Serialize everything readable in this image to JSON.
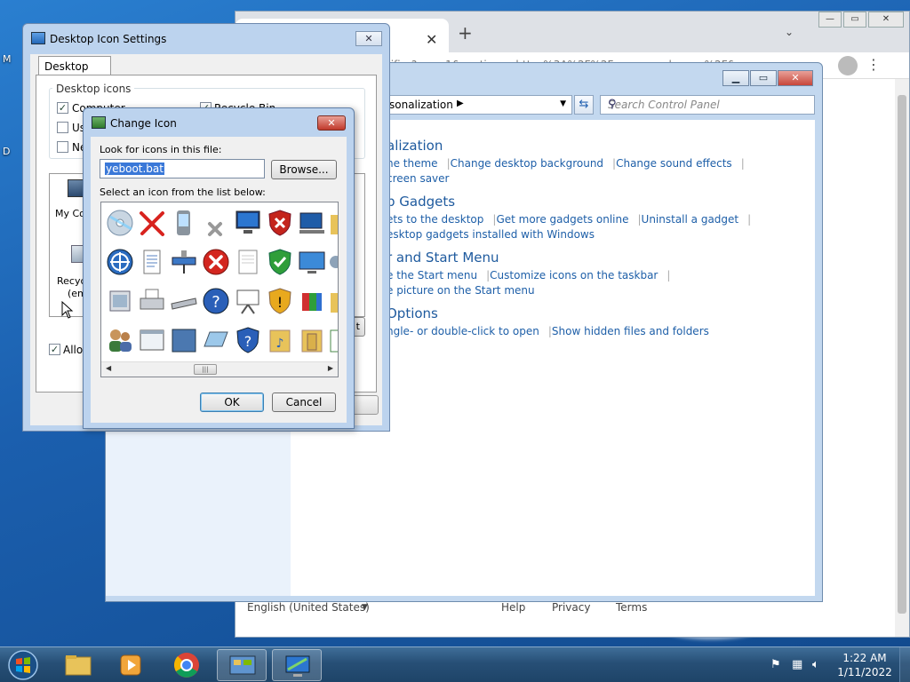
{
  "desktop": {
    "left_labels": [
      "M",
      "D"
    ]
  },
  "browser": {
    "url_text": "tifier?csn...1&continue=https%3A%2F%2Fwww.google.com%2F&",
    "footer": {
      "language": "English (United States)",
      "help": "Help",
      "privacy": "Privacy",
      "terms": "Terms"
    }
  },
  "control_panel": {
    "breadcrumb": "sonalization",
    "search_placeholder": "Search Control Panel",
    "categories": [
      {
        "title": "alization",
        "links": [
          [
            "he theme",
            "Change desktop background",
            "Change sound effects"
          ],
          [
            "creen saver"
          ]
        ]
      },
      {
        "title": "p Gadgets",
        "links": [
          [
            "ets to the desktop",
            "Get more gadgets online",
            "Uninstall a gadget"
          ],
          [
            "esktop gadgets installed with Windows"
          ]
        ]
      },
      {
        "title": "r and Start Menu",
        "links": [
          [
            "e the Start menu",
            "Customize icons on the taskbar"
          ],
          [
            "e picture on the Start menu"
          ]
        ]
      },
      {
        "title": "Options",
        "links": [
          [
            "ngle- or double-click to open",
            "Show hidden files and folders"
          ]
        ]
      }
    ]
  },
  "desktop_icon_settings": {
    "title": "Desktop Icon Settings",
    "tab": "Desktop Icons",
    "group_label": "Desktop icons",
    "checkboxes": [
      {
        "label": "Computer",
        "checked": true
      },
      {
        "label": "Use",
        "checked": false
      },
      {
        "label": "Ne",
        "checked": false
      },
      {
        "label": "Recycle Bin",
        "checked": true
      }
    ],
    "preview_labels": [
      "My Co",
      "Recyc",
      "(em"
    ],
    "allow_label": "Allow",
    "allow_checked": true,
    "partial_button": "t"
  },
  "change_icon": {
    "title": "Change Icon",
    "look_label": "Look for icons in this file:",
    "file_value": "yeboot.bat",
    "browse_label": "Browse...",
    "list_label": "Select an icon from the list below:",
    "ok_label": "OK",
    "cancel_label": "Cancel",
    "icons": [
      [
        "cd-icon",
        "red-x-icon",
        "pda-icon",
        "gray-x-icon",
        "monitor-icon",
        "red-shield-icon",
        "network-computer-icon",
        "folder-icon"
      ],
      [
        "navigation-icon",
        "document-icon",
        "network-icon",
        "error-icon",
        "blank-page-icon",
        "green-shield-icon",
        "display-icon",
        "gear-icon"
      ],
      [
        "program-icon",
        "printer-icon",
        "scanner-icon",
        "help-icon",
        "projector-icon",
        "warning-shield-icon",
        "rainbow-box-icon",
        "folder-icon"
      ],
      [
        "users-icon",
        "window-icon",
        "folder-blue-icon",
        "tablet-icon",
        "question-shield-icon",
        "music-folder-icon",
        "door-folder-icon",
        "notes-icon"
      ]
    ]
  },
  "taskbar": {
    "time": "1:22 AM",
    "date": "1/11/2022"
  },
  "colors": {
    "link": "#1e5fa8",
    "category": "#1e5a9e",
    "selection": "#3a78d8"
  }
}
